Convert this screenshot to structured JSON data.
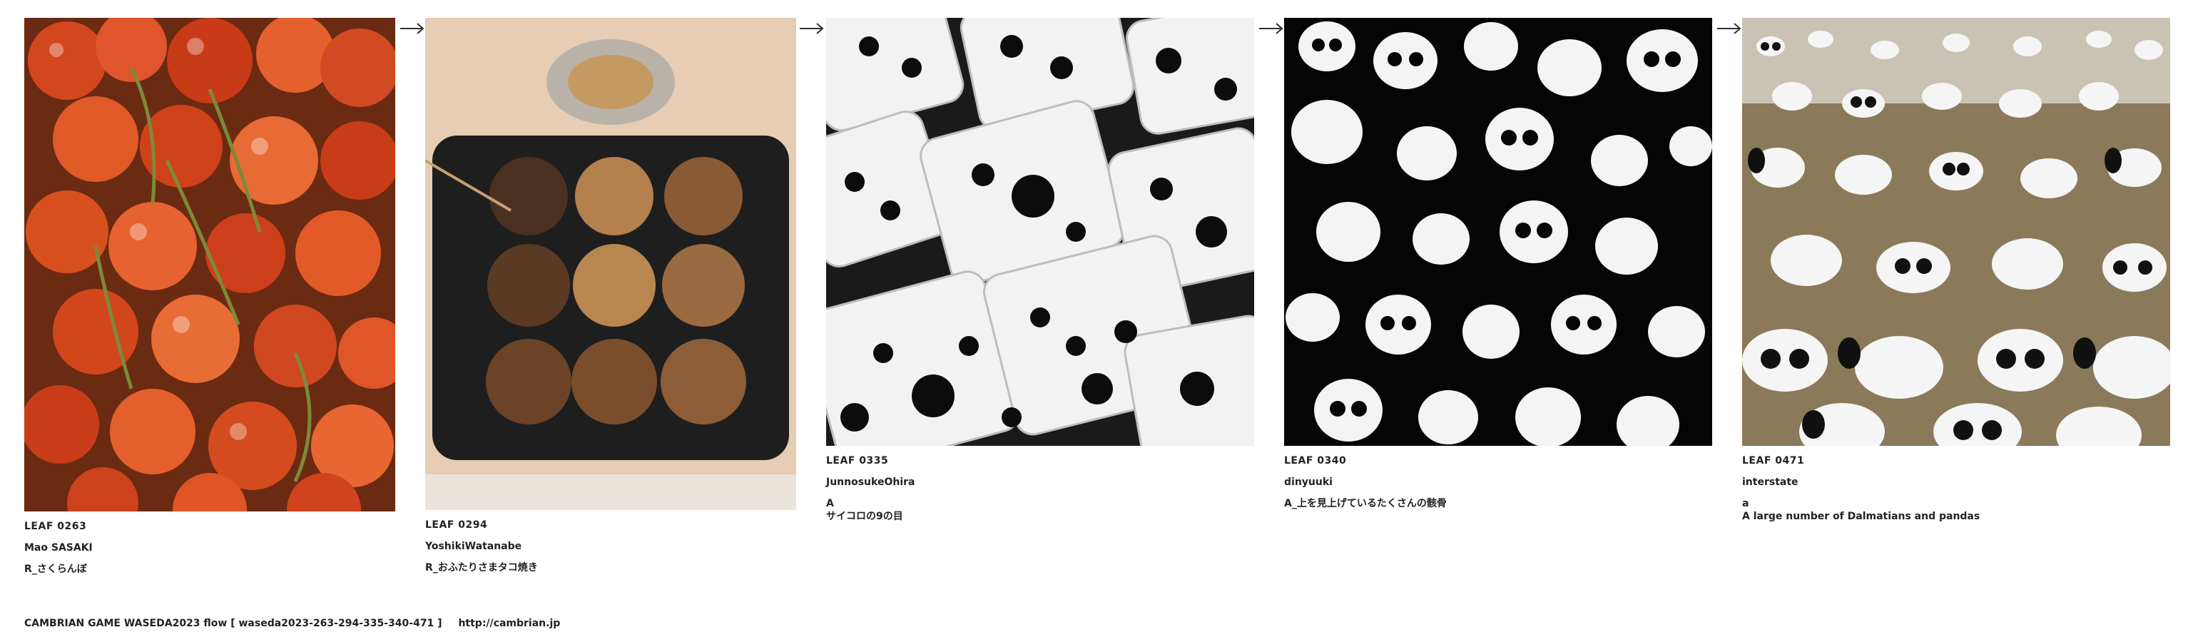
{
  "leaves": [
    {
      "id": "LEAF 0263",
      "author": "Mao SASAKI",
      "title": "R_さくらんぼ",
      "caption": ""
    },
    {
      "id": "LEAF 0294",
      "author": "YoshikiWatanabe",
      "title": "R_おふたりさまタコ焼き",
      "caption": ""
    },
    {
      "id": "LEAF 0335",
      "author": "JunnosukeOhira",
      "title": "A",
      "caption": "サイコロの9の目"
    },
    {
      "id": "LEAF 0340",
      "author": "dinyuuki",
      "title": "A_上を見上げているたくさんの骸骨",
      "caption": ""
    },
    {
      "id": "LEAF 0471",
      "author": "interstate",
      "title": "a",
      "caption": "A large number of Dalmatians and pandas"
    }
  ],
  "footer": {
    "text": "CAMBRIAN GAME  WASEDA2023  flow [ waseda2023-263-294-335-340-471 ]",
    "url": "http://cambrian.jp"
  },
  "icons": [
    "arrow-right-icon"
  ]
}
